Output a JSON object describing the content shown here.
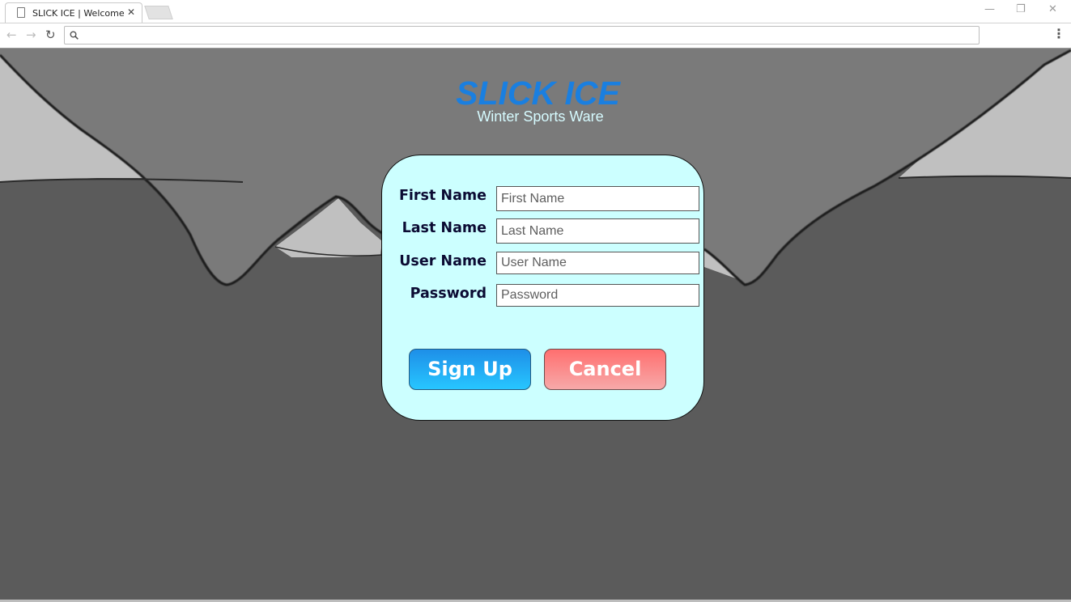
{
  "browser": {
    "tab_title": "SLICK ICE | Welcome",
    "tab_close": "✕",
    "address_value": "",
    "window_controls": {
      "minimize": "—",
      "restore": "❐",
      "close": "✕"
    },
    "nav": {
      "back": "←",
      "forward": "→",
      "reload": "↻"
    },
    "menu": "⋮"
  },
  "brand": {
    "title": "SLICK ICE",
    "subtitle": "Winter Sports Ware"
  },
  "form": {
    "fields": [
      {
        "label": "First Name",
        "placeholder": "First Name",
        "value": ""
      },
      {
        "label": "Last Name",
        "placeholder": "Last Name",
        "value": ""
      },
      {
        "label": "User Name",
        "placeholder": "User Name",
        "value": ""
      },
      {
        "label": "Password",
        "placeholder": "Password",
        "value": ""
      }
    ],
    "signup_label": "Sign Up",
    "cancel_label": "Cancel"
  },
  "colors": {
    "brand_title": "#1a7fe0",
    "brand_subtitle": "#d6fbff",
    "card_background": "#ccffff",
    "signup_button": "#27a8f5",
    "cancel_button": "#ff8a8a",
    "page_background": "#5b5b5b"
  }
}
